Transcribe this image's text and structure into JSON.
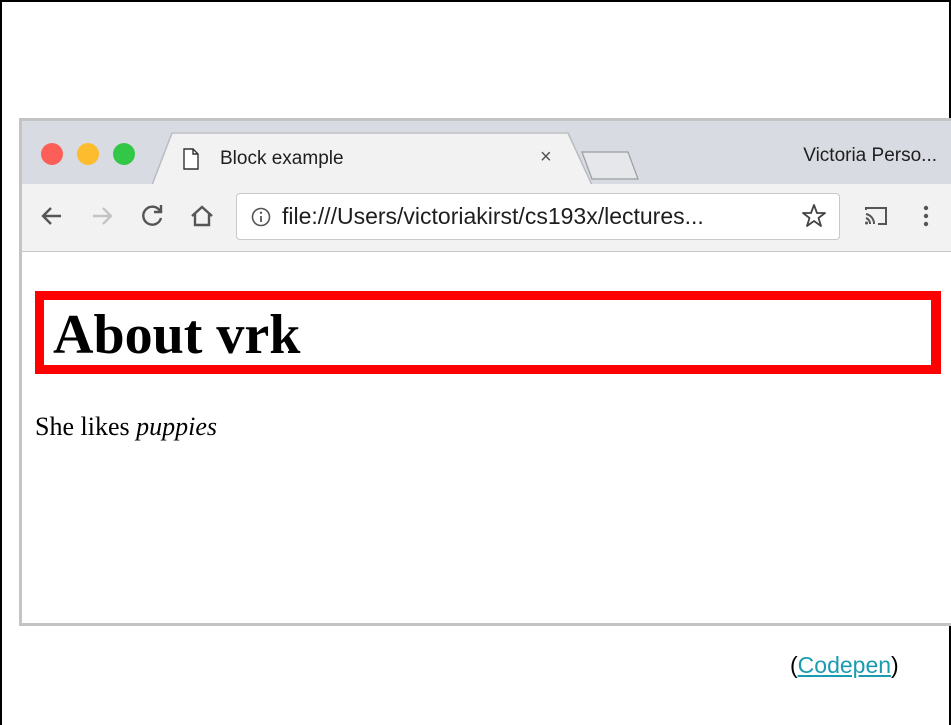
{
  "browser": {
    "tab_title": "Block example",
    "tab_close": "×",
    "profile_name": "Victoria Perso...",
    "url": "file:///Users/victoriakirst/cs193x/lectures..."
  },
  "page": {
    "heading": "About vrk",
    "paragraph_prefix": "She likes ",
    "paragraph_emphasis": "puppies"
  },
  "footer": {
    "open_paren": "(",
    "link_text": "Codepen",
    "close_paren": ")"
  },
  "colors": {
    "heading_border": "#ff0000",
    "link": "#1a9cb0"
  }
}
